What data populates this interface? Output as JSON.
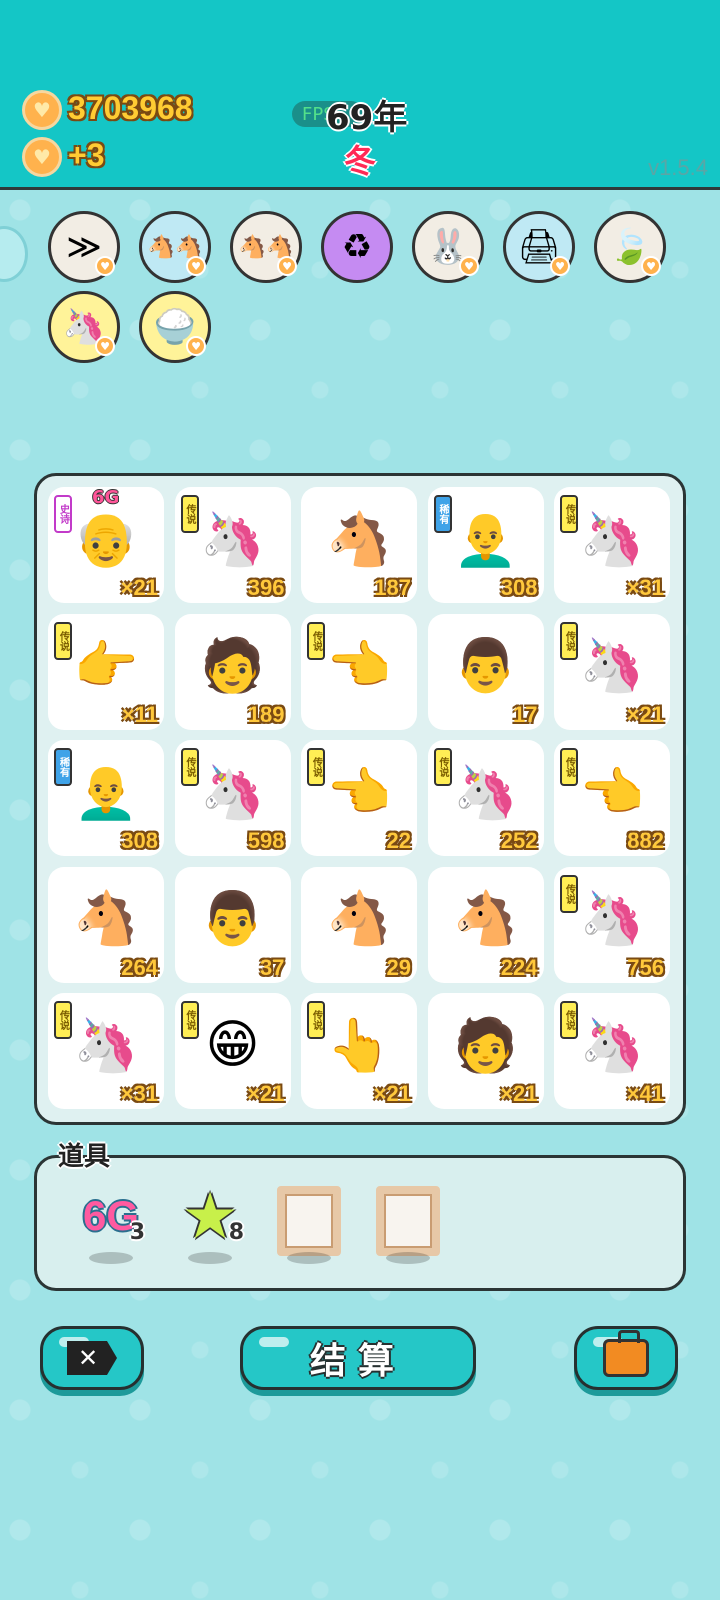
{
  "header": {
    "gold": "3703968",
    "income": "+3",
    "fps": "FPS",
    "year": "69年",
    "season": "冬",
    "version": "v1.5.4"
  },
  "skills": [
    {
      "icon": "skip-icon",
      "glyph": "≫"
    },
    {
      "icon": "double-horse-icon",
      "glyph": "🐴🐴"
    },
    {
      "icon": "double-horse-icon",
      "glyph": "🐴🐴"
    },
    {
      "icon": "recycle-icon",
      "glyph": "♻"
    },
    {
      "icon": "rabbit-icon",
      "glyph": "🐰"
    },
    {
      "icon": "printer-icon",
      "glyph": "🖨"
    },
    {
      "icon": "leaf-icon",
      "glyph": "🍃"
    },
    {
      "icon": "unicorn-icon",
      "glyph": "🦄"
    },
    {
      "icon": "rice-bowl-icon",
      "glyph": "🍚"
    }
  ],
  "tiles": [
    {
      "art": "old-man-icon",
      "glyph": "👴",
      "count": "×21",
      "tag": "史诗",
      "tier": "epic",
      "badge": "6G"
    },
    {
      "art": "unicorn-icon",
      "glyph": "🦄",
      "count": "396",
      "tag": "传说",
      "tier": "legend"
    },
    {
      "art": "horse-icon",
      "glyph": "🐴",
      "count": "187"
    },
    {
      "art": "bald-man-icon",
      "glyph": "👨‍🦲",
      "count": "308",
      "tag": "稀有",
      "tier": "rare"
    },
    {
      "art": "unicorn-icon",
      "glyph": "🦄",
      "count": "×31",
      "tag": "传说",
      "tier": "legend"
    },
    {
      "art": "pointing-hand-icon",
      "glyph": "👉",
      "count": "×11",
      "tag": "传说",
      "tier": "legend"
    },
    {
      "art": "man-face-icon",
      "glyph": "🧑",
      "count": "189"
    },
    {
      "art": "pointing-hand-icon",
      "glyph": "👈",
      "count": "",
      "tag": "传说",
      "tier": "legend"
    },
    {
      "art": "glasses-man-icon",
      "glyph": "👨",
      "count": "17"
    },
    {
      "art": "unicorn-icon",
      "glyph": "🦄",
      "count": "×21",
      "tag": "传说",
      "tier": "legend"
    },
    {
      "art": "bald-man-icon",
      "glyph": "👨‍🦲",
      "count": "308",
      "tag": "稀有",
      "tier": "rare"
    },
    {
      "art": "unicorn-icon",
      "glyph": "🦄",
      "count": "598",
      "tag": "传说",
      "tier": "legend"
    },
    {
      "art": "pointing-hand-icon",
      "glyph": "👈",
      "count": "22",
      "tag": "传说",
      "tier": "legend"
    },
    {
      "art": "unicorn-icon",
      "glyph": "🦄",
      "count": "252",
      "tag": "传说",
      "tier": "legend"
    },
    {
      "art": "pointing-hand-icon",
      "glyph": "👈",
      "count": "882",
      "tag": "传说",
      "tier": "legend"
    },
    {
      "art": "horse-icon",
      "glyph": "🐴",
      "count": "264"
    },
    {
      "art": "glasses-man-icon",
      "glyph": "👨",
      "count": "37"
    },
    {
      "art": "horse-icon",
      "glyph": "🐴",
      "count": "29"
    },
    {
      "art": "horse-icon",
      "glyph": "🐴",
      "count": "224"
    },
    {
      "art": "unicorn-icon",
      "glyph": "🦄",
      "count": "756",
      "tag": "传说",
      "tier": "legend"
    },
    {
      "art": "unicorn-icon",
      "glyph": "🦄",
      "count": "×31",
      "tag": "传说",
      "tier": "legend"
    },
    {
      "art": "smiling-man-icon",
      "glyph": "😁",
      "count": "×21",
      "tag": "传说",
      "tier": "legend"
    },
    {
      "art": "pointing-hand-icon",
      "glyph": "👆",
      "count": "×21",
      "tag": "传说",
      "tier": "legend"
    },
    {
      "art": "man-face-icon",
      "glyph": "🧑",
      "count": "×21"
    },
    {
      "art": "unicorn-icon",
      "glyph": "🦄",
      "count": "×41",
      "tag": "传说",
      "tier": "legend"
    }
  ],
  "items": {
    "label": "道具",
    "slots": [
      {
        "kind": "6g",
        "text": "6G",
        "num": "3"
      },
      {
        "kind": "star",
        "num": "8"
      },
      {
        "kind": "frame",
        "num": ""
      },
      {
        "kind": "frame",
        "num": ""
      }
    ]
  },
  "buttons": {
    "settle": "结算",
    "remove_glyph": "✕"
  }
}
